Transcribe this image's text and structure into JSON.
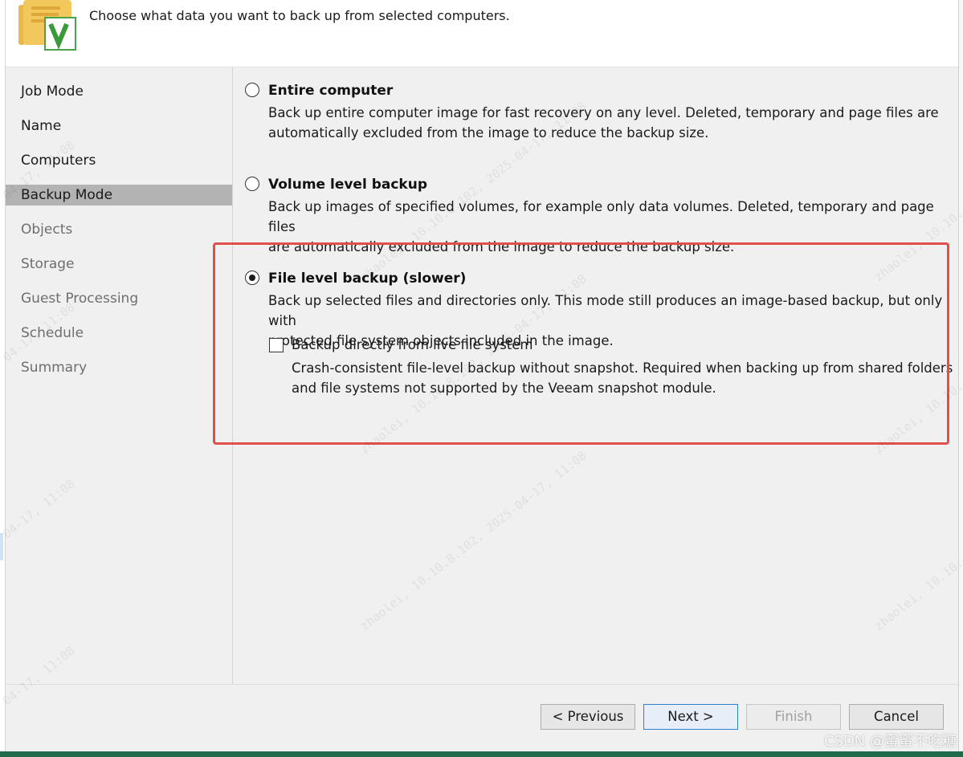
{
  "header": {
    "description": "Choose what data you want to back up from selected computers."
  },
  "nav": {
    "items": [
      {
        "label": "Job Mode",
        "state": "enabled"
      },
      {
        "label": "Name",
        "state": "enabled"
      },
      {
        "label": "Computers",
        "state": "enabled"
      },
      {
        "label": "Backup Mode",
        "state": "selected"
      },
      {
        "label": "Objects",
        "state": "disabled"
      },
      {
        "label": "Storage",
        "state": "disabled"
      },
      {
        "label": "Guest Processing",
        "state": "disabled"
      },
      {
        "label": "Schedule",
        "state": "disabled"
      },
      {
        "label": "Summary",
        "state": "disabled"
      }
    ]
  },
  "options": [
    {
      "title": "Entire computer",
      "desc_line1": "Back up entire computer image for fast recovery on any level. Deleted, temporary and page files are",
      "desc_line2": "automatically excluded from the image to reduce the backup size.",
      "selected": false
    },
    {
      "title": "Volume level backup",
      "desc_line1": "Back up images of specified volumes, for example only data volumes. Deleted, temporary and page files",
      "desc_line2": "are automatically excluded from the image to reduce the backup size.",
      "selected": false
    },
    {
      "title": "File level backup (slower)",
      "desc_line1": "Back up selected files and directories only. This mode still produces an image-based backup, but only with",
      "desc_line2": "protected file system objects included in the image.",
      "selected": true
    }
  ],
  "live_fs": {
    "label": "Backup directly from live file system",
    "desc_line1": "Crash-consistent file-level backup without snapshot. Required when backing up from shared folders",
    "desc_line2": "and file systems not supported by the Veeam snapshot module.",
    "checked": false
  },
  "footer": {
    "previous_label": "< Previous",
    "next_label": "Next >",
    "finish_label": "Finish",
    "cancel_label": "Cancel"
  },
  "watermark": {
    "user_ip": "zhaolei, 10.10.8.102, 2025-04-17, 11:08",
    "date_time": "04-17, 11:08",
    "user_ip_short": "zhaolei, 10.10."
  },
  "csdn_watermark": "CSDN @蜜蜜不吃糖",
  "colors": {
    "highlight_box": "#e0504a",
    "nav_selected": "#b3b3b3",
    "default_button_border": "#2f7fd0"
  }
}
